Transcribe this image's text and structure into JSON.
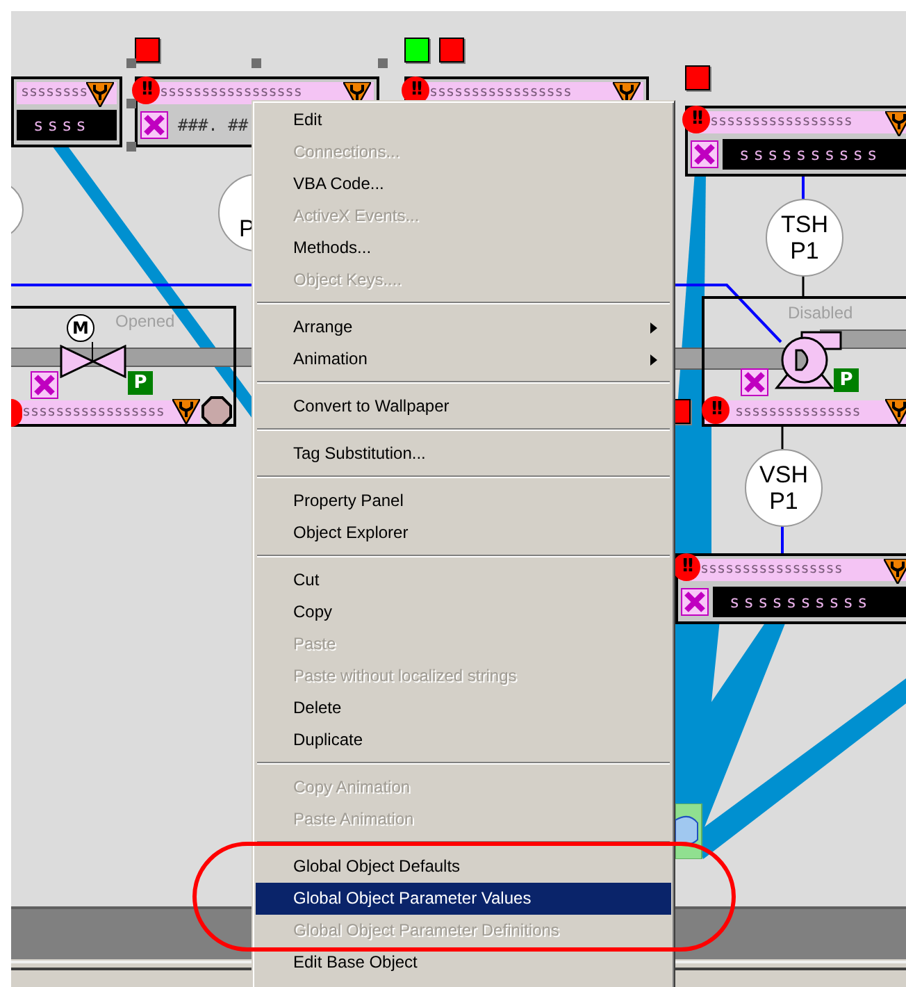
{
  "diagram": {
    "indicators": [
      {
        "color": "#ff0000"
      },
      {
        "color": "#00ff00"
      },
      {
        "color": "#ff0000"
      },
      {
        "color": "#ff0000"
      },
      {
        "color": "#ff0000"
      }
    ],
    "faceplates": [
      {
        "tag": "ssssssss",
        "value": "ssss",
        "x_mark": false,
        "selected": false
      },
      {
        "alarm": "!!",
        "tag": "sssssssssssssssss",
        "value": "###. ##",
        "x_mark": true,
        "selected": true
      },
      {
        "alarm": "!!",
        "tag": "sssssssssssssssss",
        "x_mark": false,
        "selected": false
      },
      {
        "alarm": "!!",
        "tag": "sssssssssssssssss",
        "value": "ssssssssss",
        "x_mark": true,
        "selected": false
      },
      {
        "alarm": "!!",
        "tag": "sssssssssssssssss",
        "value": "ssssssssss",
        "x_mark": true,
        "selected": false
      }
    ],
    "instruments": [
      {
        "lines": [
          "P"
        ]
      },
      {
        "lines": [
          "TSH",
          "P1"
        ]
      },
      {
        "lines": [
          "VSH",
          "P1"
        ]
      }
    ],
    "equipment": [
      {
        "kind": "valve",
        "motor": "M",
        "status": "Opened",
        "tag": "sssssssssssssssss",
        "p_label": "P",
        "alarm_dot": true
      },
      {
        "kind": "pump",
        "status": "Disabled",
        "alarm": "!!",
        "tag": "sssssssssssssss",
        "p_label": "P",
        "alarm_dot": false
      }
    ]
  },
  "menu": {
    "groups": [
      {
        "items": [
          {
            "label": "Edit",
            "disabled": false,
            "selected": false,
            "submenu": false
          },
          {
            "label": "Connections...",
            "disabled": true,
            "selected": false,
            "submenu": false
          },
          {
            "label": "VBA Code...",
            "disabled": false,
            "selected": false,
            "submenu": false
          },
          {
            "label": "ActiveX Events...",
            "disabled": true,
            "selected": false,
            "submenu": false
          },
          {
            "label": "Methods...",
            "disabled": false,
            "selected": false,
            "submenu": false
          },
          {
            "label": "Object Keys....",
            "disabled": true,
            "selected": false,
            "submenu": false
          }
        ]
      },
      {
        "items": [
          {
            "label": "Arrange",
            "disabled": false,
            "selected": false,
            "submenu": true
          },
          {
            "label": "Animation",
            "disabled": false,
            "selected": false,
            "submenu": true
          }
        ]
      },
      {
        "items": [
          {
            "label": "Convert to Wallpaper",
            "disabled": false,
            "selected": false,
            "submenu": false
          }
        ]
      },
      {
        "items": [
          {
            "label": "Tag Substitution...",
            "disabled": false,
            "selected": false,
            "submenu": false
          }
        ]
      },
      {
        "items": [
          {
            "label": "Property Panel",
            "disabled": false,
            "selected": false,
            "submenu": false
          },
          {
            "label": "Object Explorer",
            "disabled": false,
            "selected": false,
            "submenu": false
          }
        ]
      },
      {
        "items": [
          {
            "label": "Cut",
            "disabled": false,
            "selected": false,
            "submenu": false
          },
          {
            "label": "Copy",
            "disabled": false,
            "selected": false,
            "submenu": false
          },
          {
            "label": "Paste",
            "disabled": true,
            "selected": false,
            "submenu": false
          },
          {
            "label": "Paste without localized strings",
            "disabled": true,
            "selected": false,
            "submenu": false
          },
          {
            "label": "Delete",
            "disabled": false,
            "selected": false,
            "submenu": false
          },
          {
            "label": "Duplicate",
            "disabled": false,
            "selected": false,
            "submenu": false
          }
        ]
      },
      {
        "items": [
          {
            "label": "Copy Animation",
            "disabled": true,
            "selected": false,
            "submenu": false
          },
          {
            "label": "Paste Animation",
            "disabled": true,
            "selected": false,
            "submenu": false
          }
        ]
      },
      {
        "items": [
          {
            "label": "Global Object Defaults",
            "disabled": false,
            "selected": false,
            "submenu": false
          },
          {
            "label": "Global Object Parameter Values",
            "disabled": false,
            "selected": true,
            "submenu": false
          },
          {
            "label": "Global Object Parameter Definitions",
            "disabled": true,
            "selected": false,
            "submenu": false
          },
          {
            "label": "Edit Base Object",
            "disabled": false,
            "selected": false,
            "submenu": false
          }
        ]
      }
    ]
  }
}
